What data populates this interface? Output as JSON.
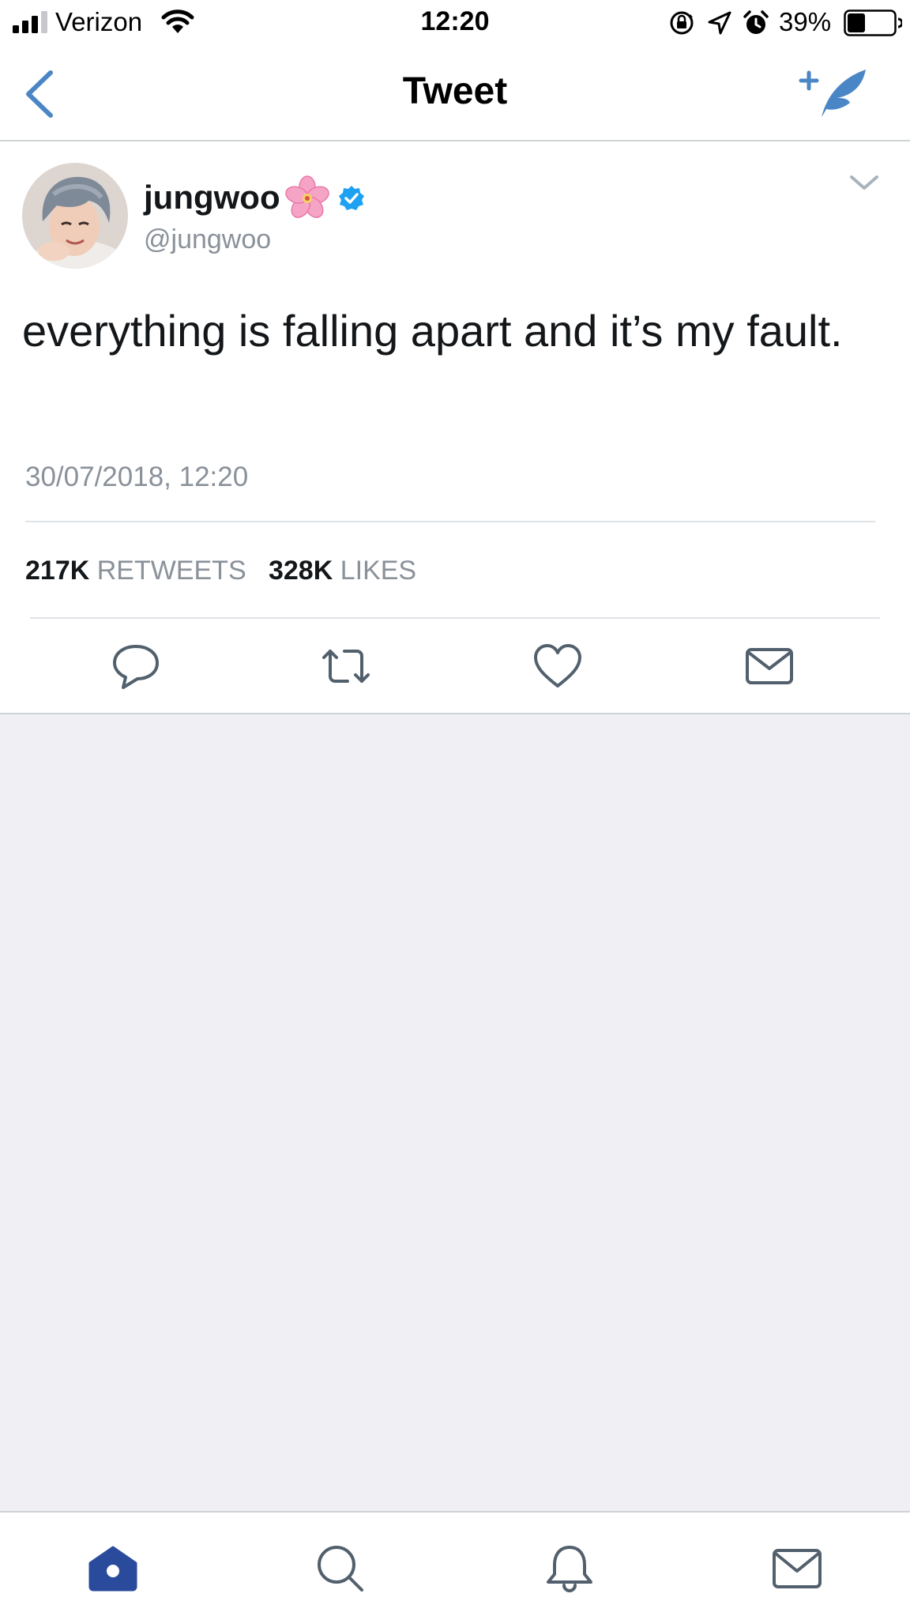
{
  "status_bar": {
    "carrier": "Verizon",
    "time": "12:20",
    "battery_percent": "39%",
    "battery_level": 0.39,
    "icons": [
      "signal-icon",
      "wifi-icon",
      "orientation-lock-icon",
      "location-icon",
      "alarm-icon",
      "battery-icon"
    ]
  },
  "header": {
    "title": "Tweet",
    "back_icon": "chevron-left-icon",
    "compose_icon": "compose-tweet-icon"
  },
  "tweet": {
    "display_name": "jungwoo",
    "name_emoji": "cherry-blossom-icon",
    "verified": true,
    "handle": "@jungwoo",
    "text": "everything is falling apart and it’s my fault.",
    "timestamp": "30/07/2018, 12:20",
    "retweets_count": "217K",
    "retweets_label": "RETWEETS",
    "likes_count": "328K",
    "likes_label": "LIKES"
  },
  "actions": [
    {
      "name": "reply",
      "icon": "reply-icon"
    },
    {
      "name": "retweet",
      "icon": "retweet-icon"
    },
    {
      "name": "like",
      "icon": "heart-icon"
    },
    {
      "name": "direct-message",
      "icon": "envelope-icon"
    }
  ],
  "tab_bar": [
    {
      "name": "home",
      "icon": "home-icon",
      "active": true
    },
    {
      "name": "search",
      "icon": "search-icon",
      "active": false
    },
    {
      "name": "notifications",
      "icon": "bell-icon",
      "active": false
    },
    {
      "name": "messages",
      "icon": "envelope-icon",
      "active": false
    }
  ],
  "colors": {
    "accent": "#1da1f2",
    "nav_blue": "#4a86c5",
    "active_tab": "#2a4b9b",
    "icon_grey": "#657786",
    "muted_text": "#8a9199",
    "background_grey": "#efeff4"
  }
}
